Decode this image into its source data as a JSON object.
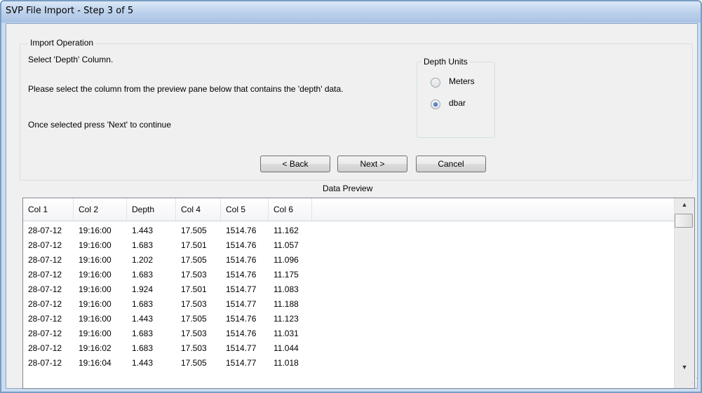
{
  "window": {
    "title": "SVP File Import - Step 3 of 5"
  },
  "import_group": {
    "title": "Import Operation",
    "heading": "Select 'Depth' Column.",
    "instruction": "Please select the column from the preview pane below that contains the 'depth' data.",
    "next_hint": "Once selected press 'Next' to continue"
  },
  "depth_units": {
    "title": "Depth Units",
    "options": [
      {
        "label": "Meters",
        "selected": false
      },
      {
        "label": "dbar",
        "selected": true
      }
    ]
  },
  "buttons": {
    "back": "< Back",
    "next": "Next >",
    "cancel": "Cancel"
  },
  "preview": {
    "title": "Data Preview",
    "columns": [
      "Col 1",
      "Col 2",
      "Depth",
      "Col 4",
      "Col 5",
      "Col 6"
    ],
    "rows": [
      [
        "28-07-12",
        "19:16:00",
        "1.443",
        "17.505",
        "1514.76",
        "11.162"
      ],
      [
        "28-07-12",
        "19:16:00",
        "1.683",
        "17.501",
        "1514.76",
        "11.057"
      ],
      [
        "28-07-12",
        "19:16:00",
        "1.202",
        "17.505",
        "1514.76",
        "11.096"
      ],
      [
        "28-07-12",
        "19:16:00",
        "1.683",
        "17.503",
        "1514.76",
        "11.175"
      ],
      [
        "28-07-12",
        "19:16:00",
        "1.924",
        "17.501",
        "1514.77",
        "11.083"
      ],
      [
        "28-07-12",
        "19:16:00",
        "1.683",
        "17.503",
        "1514.77",
        "11.188"
      ],
      [
        "28-07-12",
        "19:16:00",
        "1.443",
        "17.505",
        "1514.76",
        "11.123"
      ],
      [
        "28-07-12",
        "19:16:00",
        "1.683",
        "17.503",
        "1514.76",
        "11.031"
      ],
      [
        "28-07-12",
        "19:16:02",
        "1.683",
        "17.503",
        "1514.77",
        "11.044"
      ],
      [
        "28-07-12",
        "19:16:04",
        "1.443",
        "17.505",
        "1514.77",
        "11.018"
      ]
    ]
  },
  "icons": {
    "scroll_up": "scroll-up-arrow-icon",
    "scroll_down": "scroll-down-arrow-icon",
    "resize_grip": "resize-grip-icon"
  }
}
